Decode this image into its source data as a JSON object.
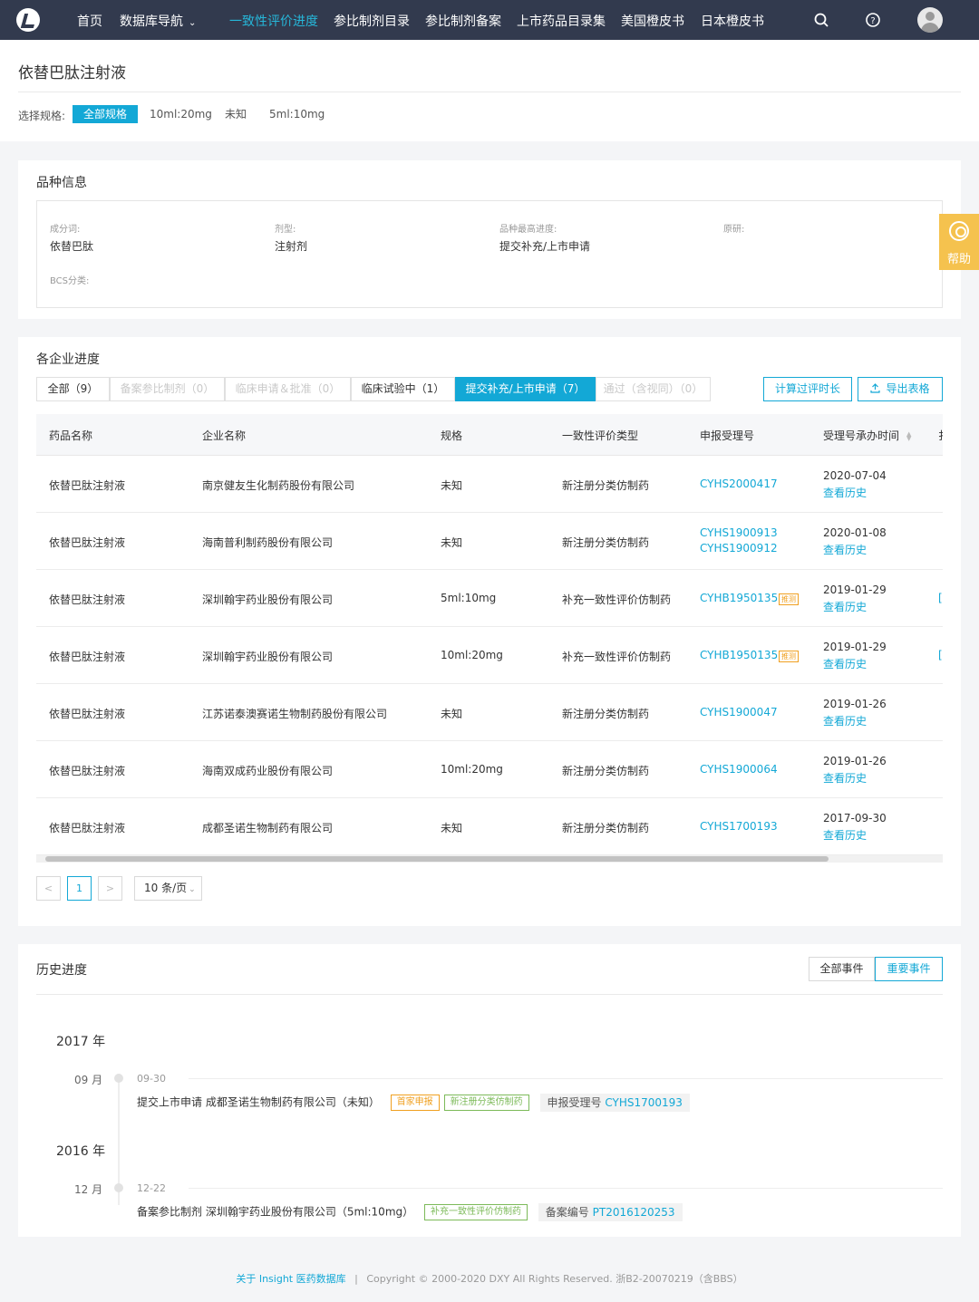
{
  "nav": {
    "items": [
      {
        "label": "首页"
      },
      {
        "label": "数据库导航"
      },
      {
        "label": "一致性评价进度"
      },
      {
        "label": "参比制剂目录"
      },
      {
        "label": "参比制剂备案"
      },
      {
        "label": "上市药品目录集"
      },
      {
        "label": "美国橙皮书"
      },
      {
        "label": "日本橙皮书"
      }
    ],
    "active_index": 2,
    "dropdown_arrow": "chevron-down-icon",
    "icons": [
      "search-icon",
      "question-icon",
      "avatar"
    ]
  },
  "page": {
    "title": "依替巴肽注射液",
    "spec_label": "选择规格:",
    "spec_options": [
      "全部规格",
      "10ml:20mg",
      "未知",
      "5ml:10mg"
    ],
    "spec_active": 0
  },
  "variety_info": {
    "title": "品种信息",
    "fields": [
      {
        "label": "成分词:",
        "value": "依替巴肽"
      },
      {
        "label": "剂型:",
        "value": "注射剂"
      },
      {
        "label": "品种最高进度:",
        "value": "提交补充/上市申请"
      },
      {
        "label": "原研:",
        "value": ""
      },
      {
        "label": "BCS分类:",
        "value": ""
      }
    ]
  },
  "help": {
    "label": "帮助",
    "icon": "help-icon"
  },
  "progress": {
    "title": "各企业进度",
    "tabs": [
      {
        "label": "全部（9）",
        "state": "normal"
      },
      {
        "label": "备案参比制剂（0）",
        "state": "disabled"
      },
      {
        "label": "临床申请＆批准（0）",
        "state": "disabled"
      },
      {
        "label": "临床试验中（1）",
        "state": "normal"
      },
      {
        "label": "提交补充/上市申请（7）",
        "state": "active"
      },
      {
        "label": "通过（含视同）（0）",
        "state": "disabled"
      }
    ],
    "calc_button": "计算过评时长",
    "export_button": "导出表格",
    "columns": [
      "药品名称",
      "企业名称",
      "规格",
      "一致性评价类型",
      "申报受理号",
      "受理号承办时间",
      "扌"
    ],
    "rows": [
      {
        "drug": "依替巴肽注射液",
        "company": "南京健友生化制药股份有限公司",
        "spec": "未知",
        "type": "新注册分类仿制药",
        "nos": [
          "CYHS2000417"
        ],
        "badge": "",
        "date": "2020-07-04",
        "history": "查看历史",
        "extra": ""
      },
      {
        "drug": "依替巴肽注射液",
        "company": "海南普利制药股份有限公司",
        "spec": "未知",
        "type": "新注册分类仿制药",
        "nos": [
          "CYHS1900913",
          "CYHS1900912"
        ],
        "badge": "",
        "date": "2020-01-08",
        "history": "查看历史",
        "extra": ""
      },
      {
        "drug": "依替巴肽注射液",
        "company": "深圳翰宇药业股份有限公司",
        "spec": "5ml:10mg",
        "type": "补充一致性评价仿制药",
        "nos": [
          "CYHB1950135"
        ],
        "badge": "推测",
        "date": "2019-01-29",
        "history": "查看历史",
        "extra": "["
      },
      {
        "drug": "依替巴肽注射液",
        "company": "深圳翰宇药业股份有限公司",
        "spec": "10ml:20mg",
        "type": "补充一致性评价仿制药",
        "nos": [
          "CYHB1950135"
        ],
        "badge": "推测",
        "date": "2019-01-29",
        "history": "查看历史",
        "extra": "["
      },
      {
        "drug": "依替巴肽注射液",
        "company": "江苏诺泰澳赛诺生物制药股份有限公司",
        "spec": "未知",
        "type": "新注册分类仿制药",
        "nos": [
          "CYHS1900047"
        ],
        "badge": "",
        "date": "2019-01-26",
        "history": "查看历史",
        "extra": ""
      },
      {
        "drug": "依替巴肽注射液",
        "company": "海南双成药业股份有限公司",
        "spec": "10ml:20mg",
        "type": "新注册分类仿制药",
        "nos": [
          "CYHS1900064"
        ],
        "badge": "",
        "date": "2019-01-26",
        "history": "查看历史",
        "extra": ""
      },
      {
        "drug": "依替巴肽注射液",
        "company": "成都圣诺生物制药有限公司",
        "spec": "未知",
        "type": "新注册分类仿制药",
        "nos": [
          "CYHS1700193"
        ],
        "badge": "",
        "date": "2017-09-30",
        "history": "查看历史",
        "extra": ""
      }
    ],
    "pager": {
      "prev": "<",
      "page": "1",
      "next": ">",
      "size": "10 条/页"
    }
  },
  "history": {
    "title": "历史进度",
    "buttons": [
      "全部事件",
      "重要事件"
    ],
    "active_button": 1,
    "groups": [
      {
        "year": "2017 年",
        "month": "09 月",
        "date": "09-30",
        "event_type": "提交上市申请",
        "company": "成都圣诺生物制药有限公司（未知）",
        "tags": [
          {
            "text": "首家申报",
            "color": "orange"
          },
          {
            "text": "新注册分类仿制药",
            "color": "green"
          }
        ],
        "ref_label": "申报受理号",
        "ref_no": "CYHS1700193"
      },
      {
        "year": "2016 年",
        "month": "12 月",
        "date": "12-22",
        "event_type": "备案参比制剂",
        "company": "深圳翰宇药业股份有限公司（5ml:10mg）",
        "tags": [
          {
            "text": "补充一致性评价仿制药",
            "color": "green"
          }
        ],
        "ref_label": "备案编号",
        "ref_no": "PT2016120253"
      }
    ]
  },
  "footer": {
    "link": "关于 Insight 医药数据库",
    "sep": "|",
    "copyright": "Copyright © 2000-2020 DXY All Rights Reserved. 浙B2-20070219（含BBS）"
  },
  "colors": {
    "nav_bg": "#323a4e",
    "accent": "#13a8d6",
    "help": "#f5c24e",
    "tag_orange": "#f0a020",
    "tag_green": "#7cba59"
  }
}
